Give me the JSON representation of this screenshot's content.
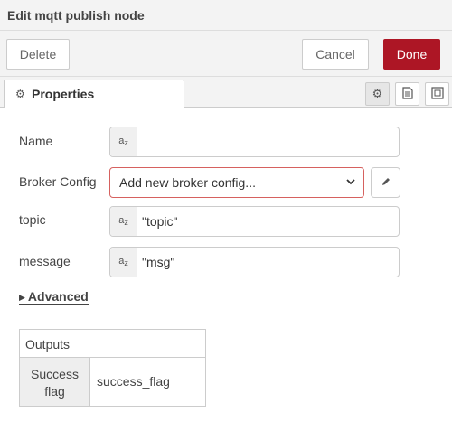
{
  "header": {
    "title": "Edit mqtt publish node"
  },
  "toolbar": {
    "delete_label": "Delete",
    "cancel_label": "Cancel",
    "done_label": "Done"
  },
  "tabs": {
    "properties_label": "Properties",
    "icons": [
      "gear-icon",
      "document-icon",
      "frame-icon"
    ]
  },
  "form": {
    "name": {
      "label": "Name",
      "value": ""
    },
    "broker": {
      "label": "Broker Config",
      "selected": "Add new broker config..."
    },
    "topic": {
      "label": "topic",
      "value": "\"topic\""
    },
    "message": {
      "label": "message",
      "value": "\"msg\""
    },
    "type_badge": "a"
  },
  "advanced": {
    "label": "Advanced"
  },
  "outputs": {
    "header": "Outputs",
    "rows": [
      {
        "key": "Success flag",
        "value": "success_flag"
      }
    ]
  },
  "colors": {
    "accent": "#ad1625",
    "error_border": "#d6615f"
  }
}
